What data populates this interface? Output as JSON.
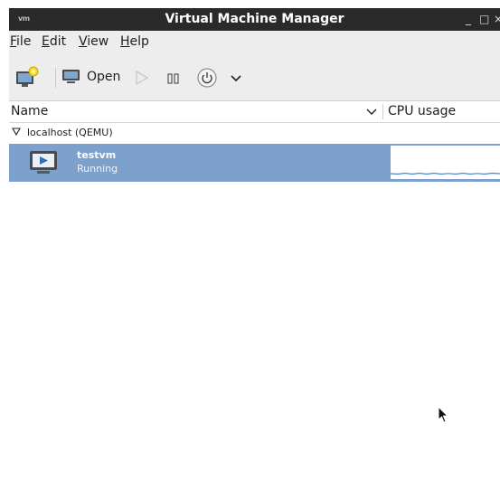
{
  "window": {
    "title": "Virtual Machine Manager",
    "app_icon_text": "vm",
    "minimize_glyph": "_",
    "maximize_glyph": "□",
    "close_glyph": "×"
  },
  "menubar": {
    "items": [
      {
        "accel": "F",
        "rest": "ile"
      },
      {
        "accel": "E",
        "rest": "dit"
      },
      {
        "accel": "V",
        "rest": "iew"
      },
      {
        "accel": "H",
        "rest": "elp"
      }
    ]
  },
  "toolbar": {
    "open_label": "Open"
  },
  "columns": {
    "name": "Name",
    "cpu": "CPU usage"
  },
  "connections": [
    {
      "label": "localhost (QEMU)",
      "vms": [
        {
          "name": "testvm",
          "status": "Running"
        }
      ]
    }
  ],
  "colors": {
    "titlebar": "#2a2a2a",
    "selection": "#7da0cc",
    "graph_line": "#4a86c8"
  }
}
